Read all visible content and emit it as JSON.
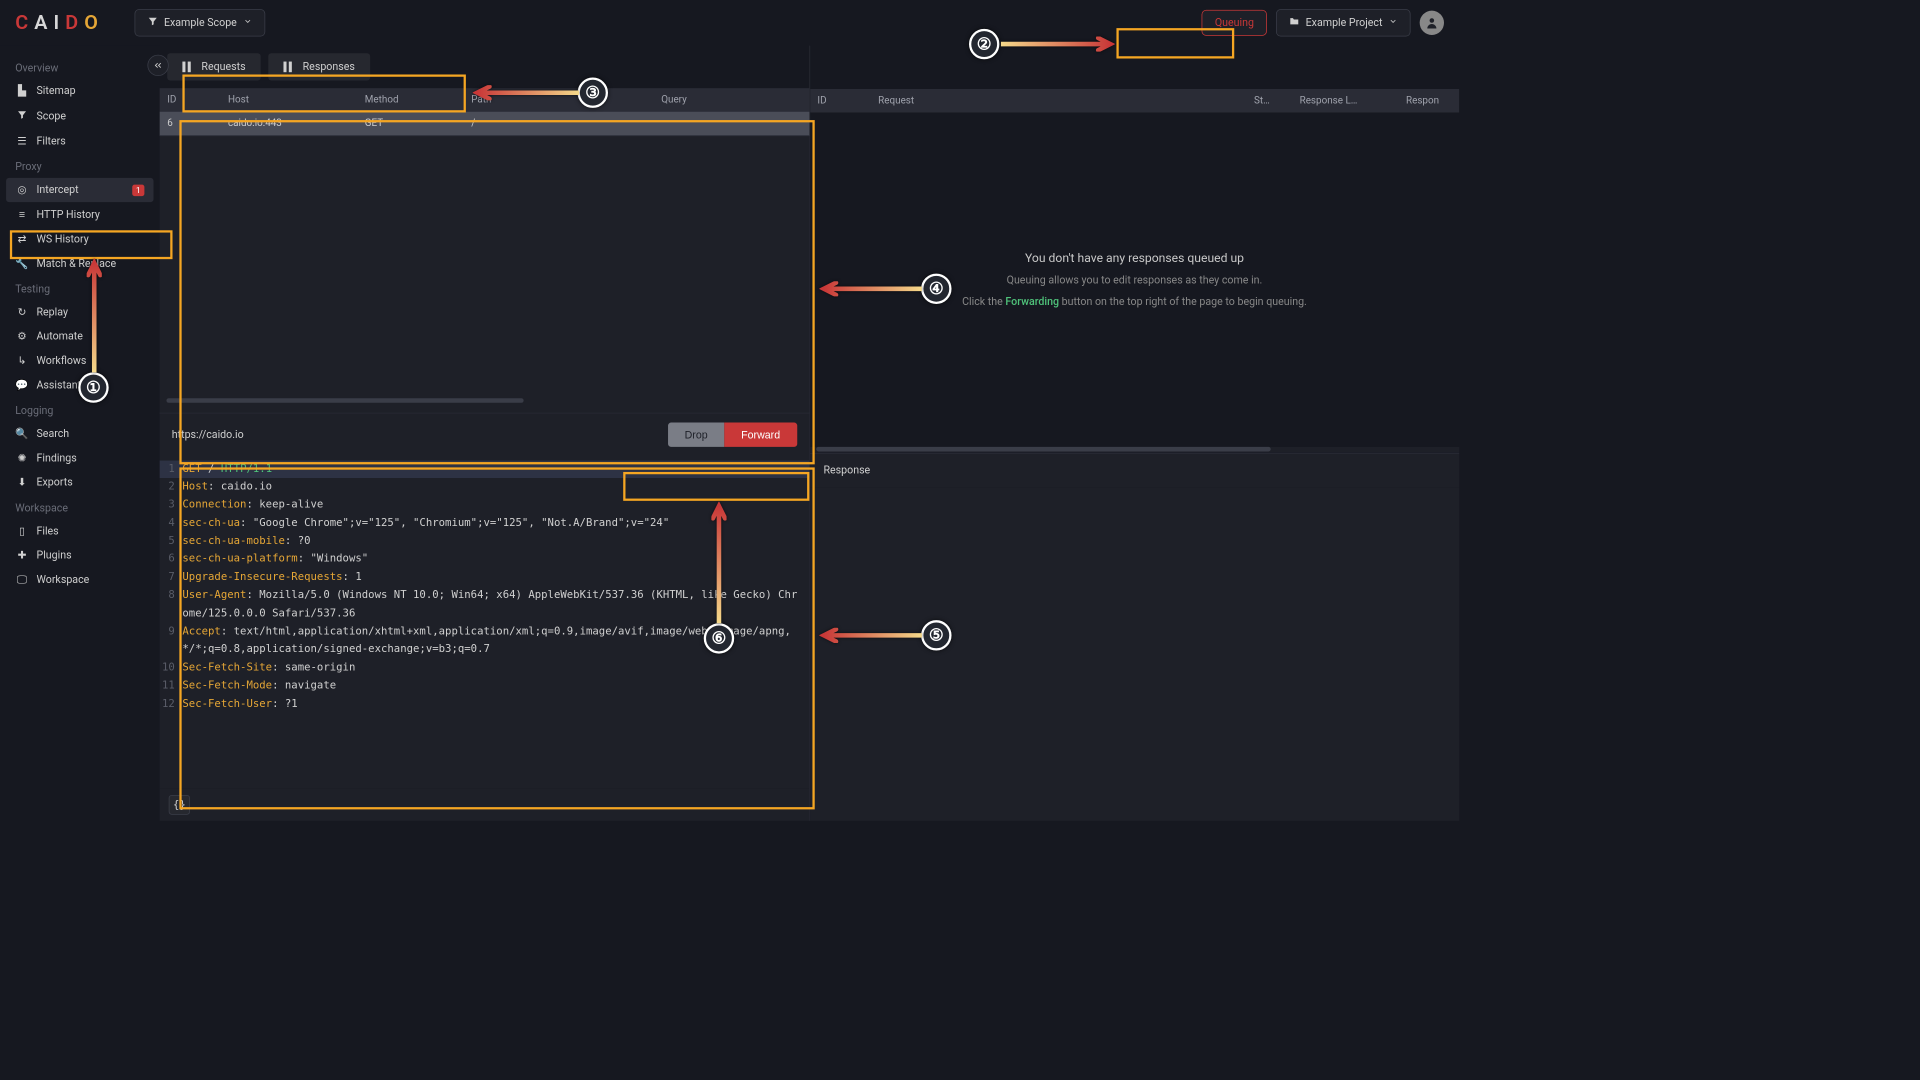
{
  "header": {
    "logo_c": "C",
    "logo_a": "A",
    "logo_i": "I",
    "logo_d": "D",
    "logo_o": "O",
    "scope_label": "Example Scope",
    "queuing_label": "Queuing",
    "project_label": "Example Project"
  },
  "sidebar": {
    "sections": {
      "overview": "Overview",
      "proxy": "Proxy",
      "testing": "Testing",
      "logging": "Logging",
      "workspace": "Workspace"
    },
    "items": {
      "sitemap": "Sitemap",
      "scope": "Scope",
      "filters": "Filters",
      "intercept": "Intercept",
      "intercept_badge": "1",
      "http_history": "HTTP History",
      "ws_history": "WS History",
      "match_replace": "Match & Replace",
      "replay": "Replay",
      "automate": "Automate",
      "workflows": "Workflows",
      "assistant": "Assistant",
      "search": "Search",
      "findings": "Findings",
      "exports": "Exports",
      "files": "Files",
      "plugins": "Plugins",
      "workspace": "Workspace"
    }
  },
  "tabs": {
    "requests": "Requests",
    "responses": "Responses"
  },
  "left_table": {
    "headers": {
      "id": "ID",
      "host": "Host",
      "method": "Method",
      "path": "Path",
      "query": "Query"
    },
    "rows": [
      {
        "id": "6",
        "host": "caido.io:443",
        "method": "GET",
        "path": "/",
        "query": ""
      }
    ]
  },
  "right_table": {
    "headers": {
      "id": "ID",
      "request": "Request",
      "st": "St…",
      "response_length": "Response L…",
      "response": "Respon"
    }
  },
  "empty": {
    "line1": "You don't have any responses queued up",
    "line2": "Queuing allows you to edit responses as they come in.",
    "line3_a": "Click the ",
    "line3_b": "Forwarding",
    "line3_c": " button on the top right of the page to begin queuing."
  },
  "detail": {
    "url": "https://caido.io",
    "drop": "Drop",
    "forward": "Forward",
    "response_label": "Response"
  },
  "code": [
    {
      "n": "1",
      "k": "GET",
      "mid": " / ",
      "p": "HTTP/1.1"
    },
    {
      "n": "2",
      "k": "Host",
      "v": ": caido.io"
    },
    {
      "n": "3",
      "k": "Connection",
      "v": ": keep-alive"
    },
    {
      "n": "4",
      "k": "sec-ch-ua",
      "v": ": \"Google Chrome\";v=\"125\", \"Chromium\";v=\"125\", \"Not.A/Brand\";v=\"24\""
    },
    {
      "n": "5",
      "k": "sec-ch-ua-mobile",
      "v": ": ?0"
    },
    {
      "n": "6",
      "k": "sec-ch-ua-platform",
      "v": ": \"Windows\""
    },
    {
      "n": "7",
      "k": "Upgrade-Insecure-Requests",
      "v": ": 1"
    },
    {
      "n": "8",
      "k": "User-Agent",
      "v": ": Mozilla/5.0 (Windows NT 10.0; Win64; x64) AppleWebKit/537.36 (KHTML, like Gecko) Chrome/125.0.0.0 Safari/537.36"
    },
    {
      "n": "9",
      "k": "Accept",
      "v": ": text/html,application/xhtml+xml,application/xml;q=0.9,image/avif,image/webp,image/apng,*/*;q=0.8,application/signed-exchange;v=b3;q=0.7"
    },
    {
      "n": "10",
      "k": "Sec-Fetch-Site",
      "v": ": same-origin"
    },
    {
      "n": "11",
      "k": "Sec-Fetch-Mode",
      "v": ": navigate"
    },
    {
      "n": "12",
      "k": "Sec-Fetch-User",
      "v": ": ?1"
    }
  ],
  "brace_label": "{}"
}
